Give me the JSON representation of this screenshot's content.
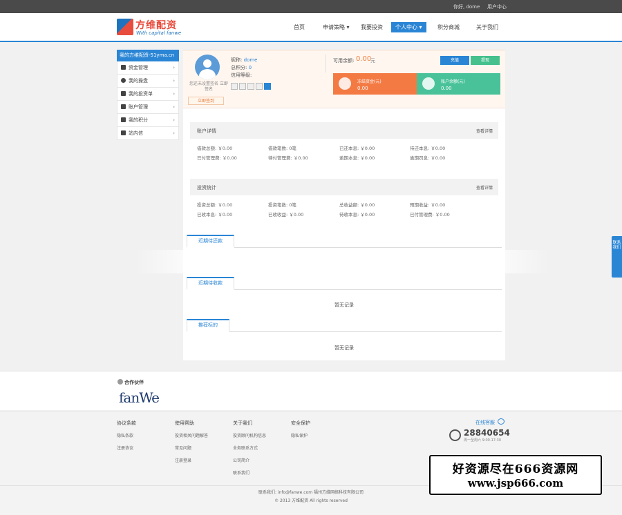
{
  "topbar": {
    "greeting": "你好, dome",
    "user_center": "用户中心"
  },
  "logo": {
    "name": "方维配资",
    "subtitle": "With capital fanwe"
  },
  "nav": [
    {
      "label": "首页"
    },
    {
      "label": "申请策略 ▾"
    },
    {
      "label": "我要投资"
    },
    {
      "label": "个人中心 ▾"
    },
    {
      "label": "积分商城"
    },
    {
      "label": "关于我们"
    }
  ],
  "sidebar": {
    "head": "我的方维配资-51yma.cn",
    "items": [
      {
        "label": "资金管理",
        "icon": "wallet-icon"
      },
      {
        "label": "我的操盘",
        "icon": "clock-icon"
      },
      {
        "label": "我的投资单",
        "icon": "list-icon"
      },
      {
        "label": "账户管理",
        "icon": "user-icon"
      },
      {
        "label": "我的积分",
        "icon": "crown-icon"
      },
      {
        "label": "站内信",
        "icon": "pen-icon"
      }
    ]
  },
  "profile": {
    "note": "您还未设置签名 立即签名",
    "sign_label": "立即签到",
    "nickname_label": "昵称:",
    "nickname": "dome",
    "score_label": "总积分:",
    "score": "0",
    "level_label": "信用等级:",
    "balance_label": "可用余额:",
    "balance": "0.00",
    "balance_unit": "元",
    "recharge": "充值",
    "withdraw": "提现",
    "card_frozen_label": "冻结资金(元)",
    "card_frozen_value": "0.00",
    "card_total_label": "账户余额(元)",
    "card_total_value": "0.00"
  },
  "account": {
    "title": "账户详情",
    "more": "查看详情",
    "cells": [
      "借款总额: ￥0.00",
      "借款笔数: 0笔",
      "已还本息: ￥0.00",
      "待还本息: ￥0.00",
      "已付管理费: ￥0.00",
      "待付管理费: ￥0.00",
      "逾期本息: ￥0.00",
      "逾期罚息: ￥0.00"
    ]
  },
  "invest": {
    "title": "投资统计",
    "more": "查看详情",
    "cells": [
      "投资总额: ￥0.00",
      "投资笔数: 0笔",
      "总收益额: ￥0.00",
      "预期收益: ￥0.00",
      "已收本息: ￥0.00",
      "已收收益: ￥0.00",
      "待收本息: ￥0.00",
      "已付管理费: ￥0.00"
    ]
  },
  "tabs": {
    "repay": "近期待还款",
    "collect": "近期待收款",
    "recommend": "推荐标的"
  },
  "empty": "暂无记录",
  "float_tab": "联系我们",
  "partners": {
    "title": "合作伙伴",
    "logo": "fanWe"
  },
  "footer": {
    "cols": [
      {
        "title": "协议条款",
        "links": [
          "隐私条款",
          "注册协议"
        ]
      },
      {
        "title": "使用帮助",
        "links": [
          "投资相关问题解答",
          "常见问题",
          "注册登录"
        ]
      },
      {
        "title": "关于我们",
        "links": [
          "投资顾问机构信息",
          "业务联系方式",
          "公司简介",
          "联系我们"
        ]
      },
      {
        "title": "安全保护",
        "links": [
          "隐私保护"
        ]
      }
    ],
    "online": "在线客服",
    "phone": "28840654",
    "hours": "周一至周六 9:00-17:30",
    "copy1": "联系我们: info@fanwe.com    福州方维网络科技有限公司",
    "copy2": "© 2013 方维配资 All rights reserved"
  },
  "watermark": {
    "line1": "好资源尽在666资源网",
    "line2": "www.jsp666.com"
  }
}
